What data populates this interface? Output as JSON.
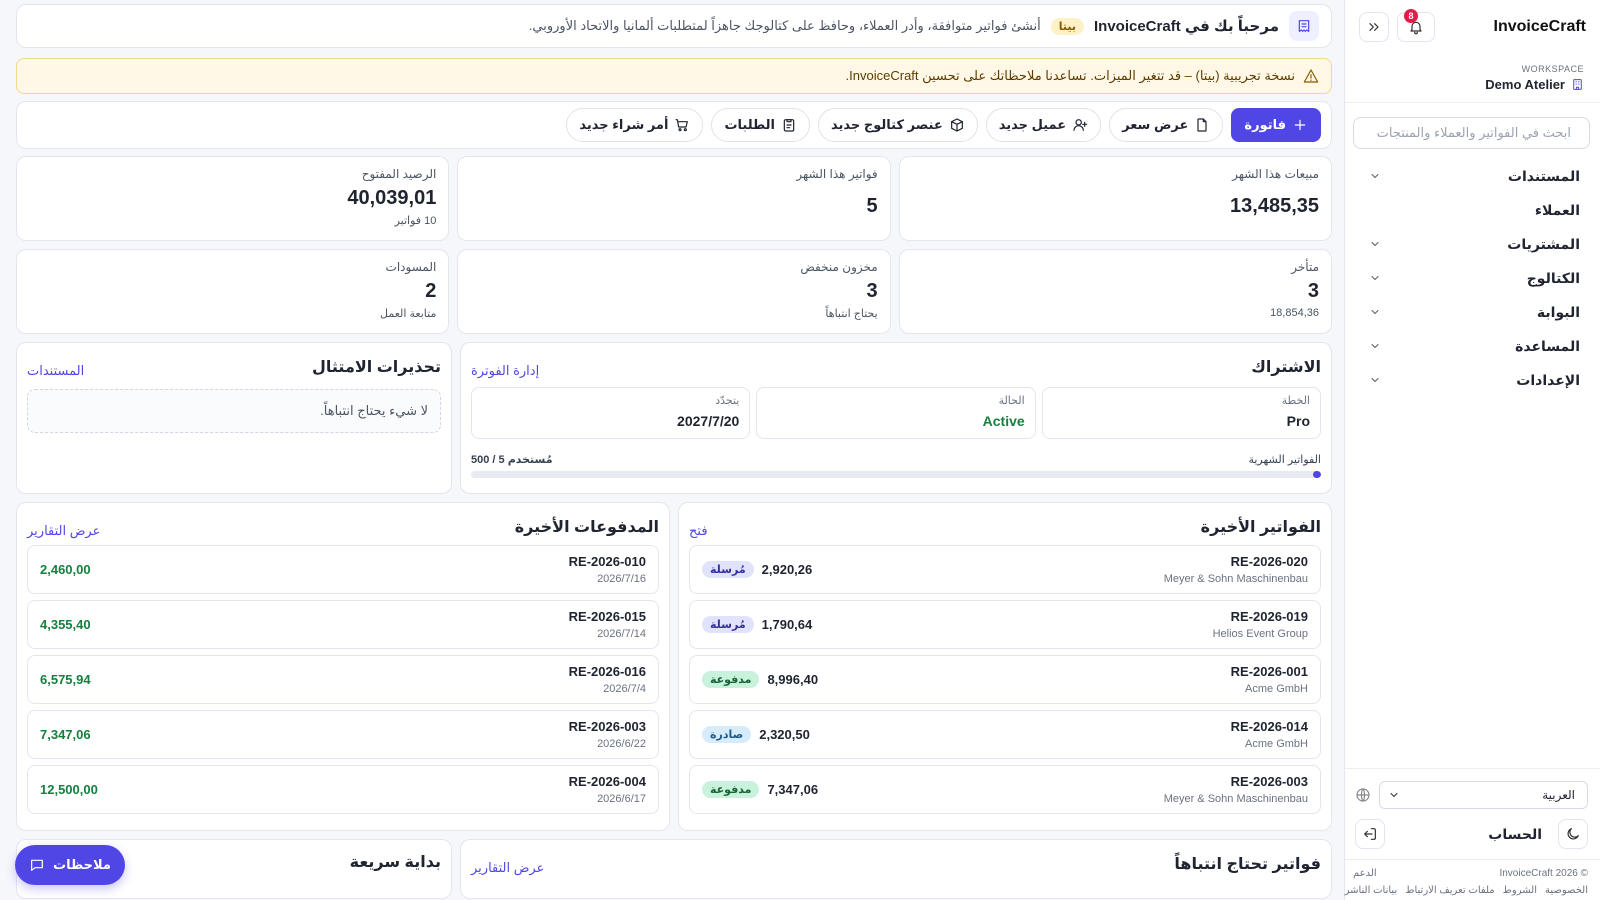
{
  "sidebar": {
    "brand": "InvoiceCraft",
    "notifications_count": "8",
    "workspace_label": "WORKSPACE",
    "workspace_name": "Demo Atelier",
    "search_placeholder": "ابحث في الفواتير والعملاء والمنتجات",
    "nav": [
      {
        "label": "المستندات",
        "chevron": true
      },
      {
        "label": "العملاء",
        "chevron": false
      },
      {
        "label": "المشتريات",
        "chevron": true
      },
      {
        "label": "الكتالوج",
        "chevron": true
      },
      {
        "label": "البوابة",
        "chevron": true
      },
      {
        "label": "المساعدة",
        "chevron": true
      },
      {
        "label": "الإعدادات",
        "chevron": true
      }
    ],
    "language": "العربية",
    "account_label": "الحساب",
    "footer": {
      "copyright": "© 2026 InvoiceCraft",
      "support": "الدعم",
      "links": [
        "الخصوصية",
        "الشروط",
        "ملفات تعريف الارتباط",
        "بيانات الناشر"
      ]
    }
  },
  "welcome": {
    "title": "مرحباً بك في InvoiceCraft",
    "beta": "بيتا",
    "subtitle": "أنشئ فواتير متوافقة، وأدر العملاء، وحافظ على كتالوجك جاهزاً لمتطلبات ألمانيا والاتحاد الأوروبي."
  },
  "beta_banner": "نسخة تجريبية (بيتا) – قد تتغير الميزات. تساعدنا ملاحظاتك على تحسين InvoiceCraft.",
  "toolbar": {
    "invoice": "فاتورة",
    "quote": "عرض سعر",
    "customer": "عميل جديد",
    "catalog": "عنصر كتالوج جديد",
    "orders": "الطلبات",
    "purchase": "أمر شراء جديد"
  },
  "stats": [
    {
      "label": "مبيعات هذا الشهر",
      "value": "13,485,35",
      "sub": ""
    },
    {
      "label": "فواتير هذا الشهر",
      "value": "5",
      "sub": ""
    },
    {
      "label": "الرصيد المفتوح",
      "value": "40,039,01",
      "sub": "10 فواتير"
    },
    {
      "label": "متأخر",
      "value": "3",
      "sub": "18,854,36"
    },
    {
      "label": "مخزون منخفض",
      "value": "3",
      "sub": "يحتاج انتباهاً"
    },
    {
      "label": "المسودات",
      "value": "2",
      "sub": "متابعة العمل"
    }
  ],
  "subscription": {
    "title": "الاشتراك",
    "manage_link": "إدارة الفوترة",
    "plan_label": "الخطة",
    "plan_value": "Pro",
    "status_label": "الحالة",
    "status_value": "Active",
    "renews_label": "يتجدّد",
    "renews_value": "2027/7/20",
    "usage_label": "الفواتير الشهرية",
    "usage_value": "مُستخدم 5 / 500",
    "usage_fraction": 0.01
  },
  "compliance": {
    "title": "تحذيرات الامتثال",
    "link": "المستندات",
    "empty": "لا شيء يحتاج انتباهاً."
  },
  "recent_invoices": {
    "title": "الفواتير الأخيرة",
    "link": "فتح",
    "items": [
      {
        "no": "RE-2026-020",
        "client": "Meyer & Sohn Maschinenbau",
        "amount": "2,920,26",
        "status": "مُرسلة",
        "kind": "sent"
      },
      {
        "no": "RE-2026-019",
        "client": "Helios Event Group",
        "amount": "1,790,64",
        "status": "مُرسلة",
        "kind": "sent"
      },
      {
        "no": "RE-2026-001",
        "client": "Acme GmbH",
        "amount": "8,996,40",
        "status": "مدفوعة",
        "kind": "paid"
      },
      {
        "no": "RE-2026-014",
        "client": "Acme GmbH",
        "amount": "2,320,50",
        "status": "صادرة",
        "kind": "issued"
      },
      {
        "no": "RE-2026-003",
        "client": "Meyer & Sohn Maschinenbau",
        "amount": "7,347,06",
        "status": "مدفوعة",
        "kind": "paid"
      }
    ]
  },
  "recent_payments": {
    "title": "المدفوعات الأخيرة",
    "link": "عرض التقارير",
    "items": [
      {
        "no": "RE-2026-010",
        "date": "2026/7/16",
        "amount": "2,460,00"
      },
      {
        "no": "RE-2026-015",
        "date": "2026/7/14",
        "amount": "4,355,40"
      },
      {
        "no": "RE-2026-016",
        "date": "2026/7/4",
        "amount": "6,575,94"
      },
      {
        "no": "RE-2026-003",
        "date": "2026/6/22",
        "amount": "7,347,06"
      },
      {
        "no": "RE-2026-004",
        "date": "2026/6/17",
        "amount": "12,500,00"
      }
    ]
  },
  "attention": {
    "title": "فواتير تحتاج انتباهاً",
    "link": "عرض التقارير"
  },
  "quickstart": {
    "title": "بداية سريعة"
  },
  "feedback": "ملاحظات"
}
